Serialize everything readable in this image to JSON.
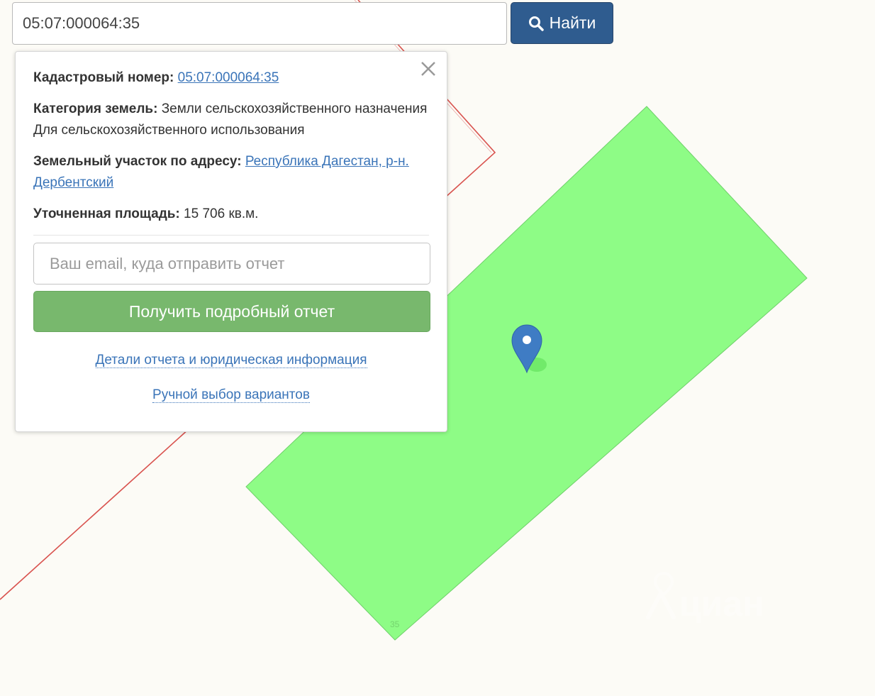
{
  "search": {
    "value": "05:07:000064:35",
    "button_label": "Найти"
  },
  "popup": {
    "cadastral_label": "Кадастровый номер:",
    "cadastral_value": "05:07:000064:35",
    "category_label": "Категория земель:",
    "category_value": "Земли сельскохозяйственного назначения",
    "usage": "Для сельскохозяйственного использования",
    "address_label": "Земельный участок по адресу:",
    "address_value": "Республика Дагестан, р-н. Дербентский",
    "area_label": "Уточненная площадь:",
    "area_value": "15 706 кв.м.",
    "email_placeholder": "Ваш email, куда отправить отчет",
    "report_button": "Получить подробный отчет",
    "details_link": "Детали отчета и юридическая информация",
    "manual_link": "Ручной выбор вариантов"
  },
  "map": {
    "parcel_label": "35",
    "watermark": "циан",
    "colors": {
      "background": "#fcfbf6",
      "parcel_fill": "#8efc86",
      "boundary": "#d9534f",
      "marker": "#3f7cc4",
      "accent_button": "#2f5c8f",
      "report_button": "#78b86d"
    }
  }
}
